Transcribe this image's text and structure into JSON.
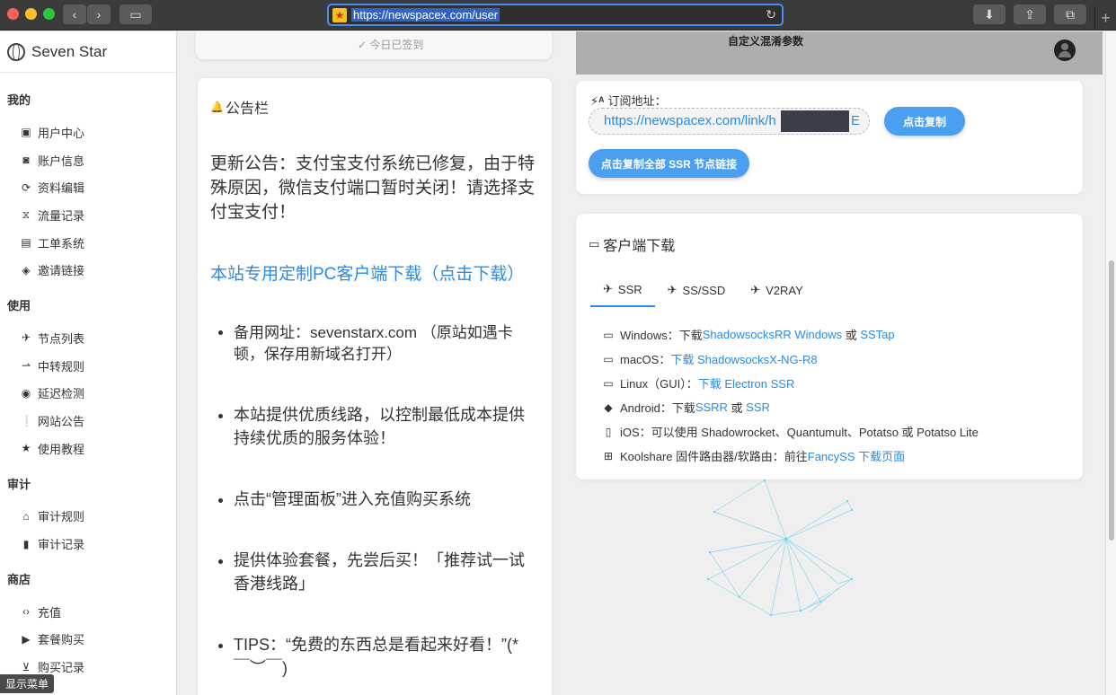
{
  "browser": {
    "url": "https://newspacex.com/user",
    "favicon": "star-icon"
  },
  "sidebar": {
    "brand": "Seven Star",
    "sections": [
      {
        "title": "我的",
        "items": [
          {
            "label": "用户中心",
            "icon": "wallet-icon"
          },
          {
            "label": "账户信息",
            "icon": "account-box-icon"
          },
          {
            "label": "资料编辑",
            "icon": "sync-icon"
          },
          {
            "label": "流量记录",
            "icon": "hourglass-icon"
          },
          {
            "label": "工单系统",
            "icon": "forum-icon"
          },
          {
            "label": "邀请链接",
            "icon": "tag-icon"
          }
        ]
      },
      {
        "title": "使用",
        "items": [
          {
            "label": "节点列表",
            "icon": "airplane-icon"
          },
          {
            "label": "中转规则",
            "icon": "transfer-icon"
          },
          {
            "label": "延迟检测",
            "icon": "eye-icon"
          },
          {
            "label": "网站公告",
            "icon": "announcement-icon"
          },
          {
            "label": "使用教程",
            "icon": "star-icon"
          }
        ]
      },
      {
        "title": "审计",
        "items": [
          {
            "label": "审计规则",
            "icon": "bank-icon"
          },
          {
            "label": "审计记录",
            "icon": "clipboard-alert-icon"
          }
        ]
      },
      {
        "title": "商店",
        "items": [
          {
            "label": "充值",
            "icon": "code-icon"
          },
          {
            "label": "套餐购买",
            "icon": "shop-icon"
          },
          {
            "label": "购买记录",
            "icon": "cart-icon"
          }
        ]
      }
    ],
    "show_menu": "显示菜单"
  },
  "top": {
    "checkin": "✓ 今日已签到",
    "obfs_title": "自定义混淆参数"
  },
  "notice": {
    "title": "公告栏",
    "update": "更新公告：支付宝支付系统已修复，由于特殊原因，微信支付端口暂时关闭！请选择支付宝支付！",
    "client_link": "本站专用定制PC客户端下载（点击下载）",
    "bullets": [
      "备用网址：sevenstarx.com （原站如遇卡顿，保存用新域名打开）",
      "本站提供优质线路，以控制最低成本提供持续优质的服务体验！",
      "点击“管理面板”进入充值购买系统",
      "提供体验套餐，先尝后买！「推荐试一试香港线路」",
      "TIPS：“免费的东西总是看起来好看！”(*￣︶￣)"
    ]
  },
  "subscription": {
    "label": "订阅地址：",
    "url": "https://newspacex.com/link/h",
    "url_tail": "E",
    "copy_button": "点击复制",
    "copy_all_button": "点击复制全部 SSR 节点链接"
  },
  "client": {
    "title": "客户端下载",
    "tabs": [
      {
        "label": "SSR",
        "icon": "airplane-icon",
        "active": true
      },
      {
        "label": "SS/SSD",
        "icon": "flight-takeoff-icon",
        "active": false
      },
      {
        "label": "V2RAY",
        "icon": "flight-land-icon",
        "active": false
      }
    ],
    "windows": {
      "prefix": "Windows：下载 ",
      "link1": "ShadowsocksRR Windows",
      "mid": " 或 ",
      "link2": "SSTap"
    },
    "macos": {
      "prefix": "macOS：",
      "link1": "下载 ShadowsocksX-NG-R8"
    },
    "linux": {
      "prefix": "Linux（GUI）：",
      "link1": "下载 Electron SSR"
    },
    "android": {
      "prefix": "Android：下载 ",
      "link1": "SSRR",
      "mid": " 或 ",
      "link2": "SSR"
    },
    "ios": {
      "text": "iOS：可以使用 Shadowrocket、Quantumult、Potatso 或 Potatso Lite"
    },
    "koolshare": {
      "prefix": "Koolshare 固件路由器/软路由：前往 ",
      "link1": "FancySS 下载页面"
    }
  },
  "colors": {
    "accent": "#2b8ae3",
    "button": "#4a9ff0",
    "network_lines": "#6ed3f0"
  }
}
